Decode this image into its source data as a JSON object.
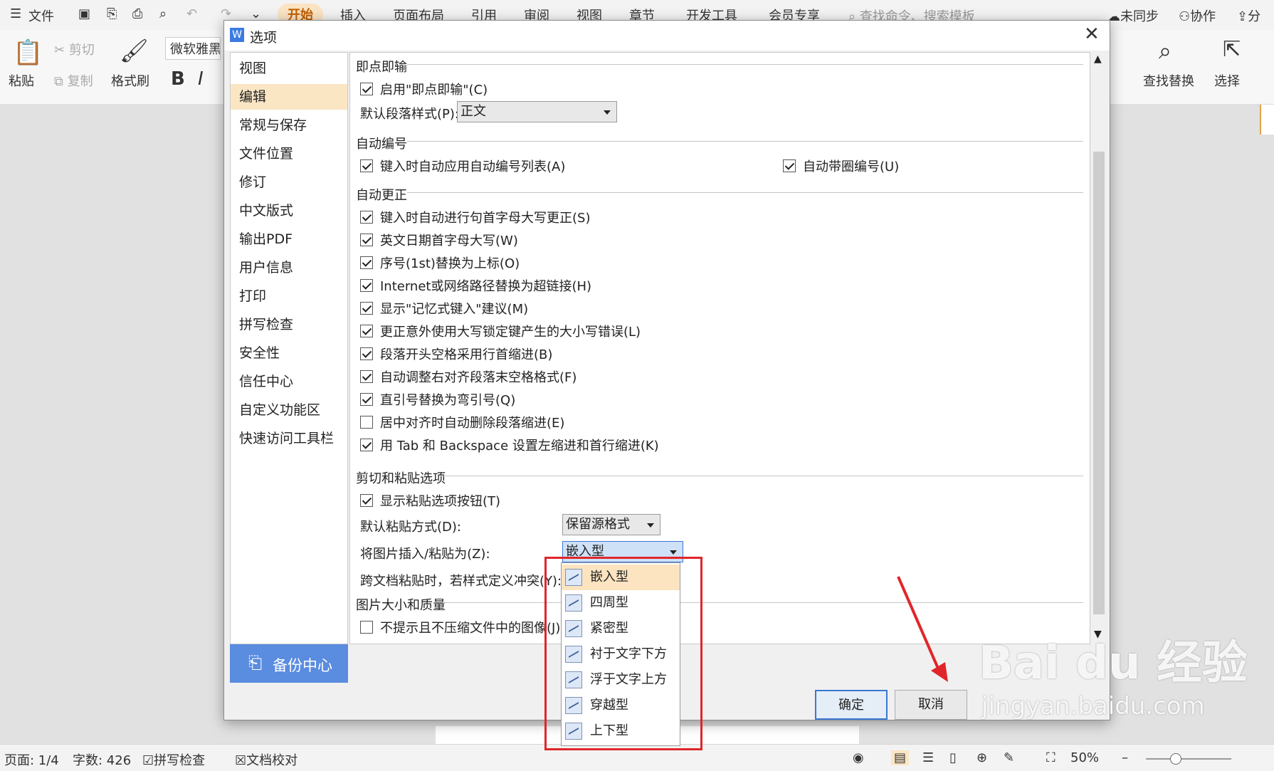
{
  "menubar": {
    "file_label": "文件",
    "tabs": [
      "开始",
      "插入",
      "页面布局",
      "引用",
      "审阅",
      "视图",
      "章节",
      "开发工具",
      "会员专享"
    ],
    "search_placeholder": "查找命令、搜索模板",
    "sync_label": "未同步",
    "collab_label": "协作",
    "share_label": "分"
  },
  "ribbon": {
    "paste": "粘贴",
    "cut": "剪切",
    "copy": "复制",
    "format_painter": "格式刷",
    "font_name": "微软雅黑",
    "bold": "B",
    "italic": "I",
    "find_replace": "查找替换",
    "select": "选择"
  },
  "dialog": {
    "title": "选项",
    "nav": [
      "视图",
      "编辑",
      "常规与保存",
      "文件位置",
      "修订",
      "中文版式",
      "输出PDF",
      "用户信息",
      "打印",
      "拼写检查",
      "安全性",
      "信任中心",
      "自定义功能区",
      "快速访问工具栏"
    ],
    "nav_selected": 1,
    "backup": "备份中心",
    "sections": {
      "click_type": {
        "title": "即点即输",
        "enable": {
          "label": "启用\"即点即输\"(C)",
          "checked": true
        },
        "default_style_label": "默认段落样式(P):",
        "default_style_value": "正文"
      },
      "auto_number": {
        "title": "自动编号",
        "items": [
          {
            "label": "键入时自动应用自动编号列表(A)",
            "checked": true
          },
          {
            "label": "自动带圈编号(U)",
            "checked": true
          }
        ]
      },
      "auto_correct": {
        "title": "自动更正",
        "items": [
          {
            "label": "键入时自动进行句首字母大写更正(S)",
            "checked": true
          },
          {
            "label": "英文日期首字母大写(W)",
            "checked": true
          },
          {
            "label": "序号(1st)替换为上标(O)",
            "checked": true
          },
          {
            "label": "Internet或网络路径替换为超链接(H)",
            "checked": true
          },
          {
            "label": "显示\"记忆式键入\"建议(M)",
            "checked": true
          },
          {
            "label": "更正意外使用大写锁定键产生的大小写错误(L)",
            "checked": true
          },
          {
            "label": "段落开头空格采用行首缩进(B)",
            "checked": true
          },
          {
            "label": "自动调整右对齐段落末空格格式(F)",
            "checked": true
          },
          {
            "label": "直引号替换为弯引号(Q)",
            "checked": true
          },
          {
            "label": "居中对齐时自动删除段落缩进(E)",
            "checked": false
          },
          {
            "label": "用 Tab 和 Backspace 设置左缩进和首行缩进(K)",
            "checked": true
          }
        ]
      },
      "cut_paste": {
        "title": "剪切和粘贴选项",
        "show_paste_btn": {
          "label": "显示粘贴选项按钮(T)",
          "checked": true
        },
        "default_paste_label": "默认粘贴方式(D):",
        "default_paste_value": "保留源格式",
        "insert_pic_label": "将图片插入/粘贴为(Z):",
        "insert_pic_value": "嵌入型",
        "cross_doc_label": "跨文档粘贴时，若样式定义冲突(Y):"
      },
      "image": {
        "title": "图片大小和质量",
        "no_compress": {
          "label": "不提示且不压缩文件中的图像(J)",
          "checked": false
        }
      }
    },
    "dropdown_options": [
      "嵌入型",
      "四周型",
      "紧密型",
      "衬于文字下方",
      "浮于文字上方",
      "穿越型",
      "上下型"
    ],
    "dropdown_highlight": 0,
    "ok_label": "确定",
    "cancel_label": "取消"
  },
  "statusbar": {
    "page": "页面: 1/4",
    "words": "字数: 426",
    "spell": "拼写检查",
    "proof": "文档校对",
    "zoom": "50%"
  },
  "watermark": {
    "brand": "Bai du 经验",
    "url": "jingyan.baidu.com"
  },
  "colors": {
    "accent": "#5a8ce0",
    "highlight": "#fbe6c4",
    "annotation": "#e0262a"
  }
}
